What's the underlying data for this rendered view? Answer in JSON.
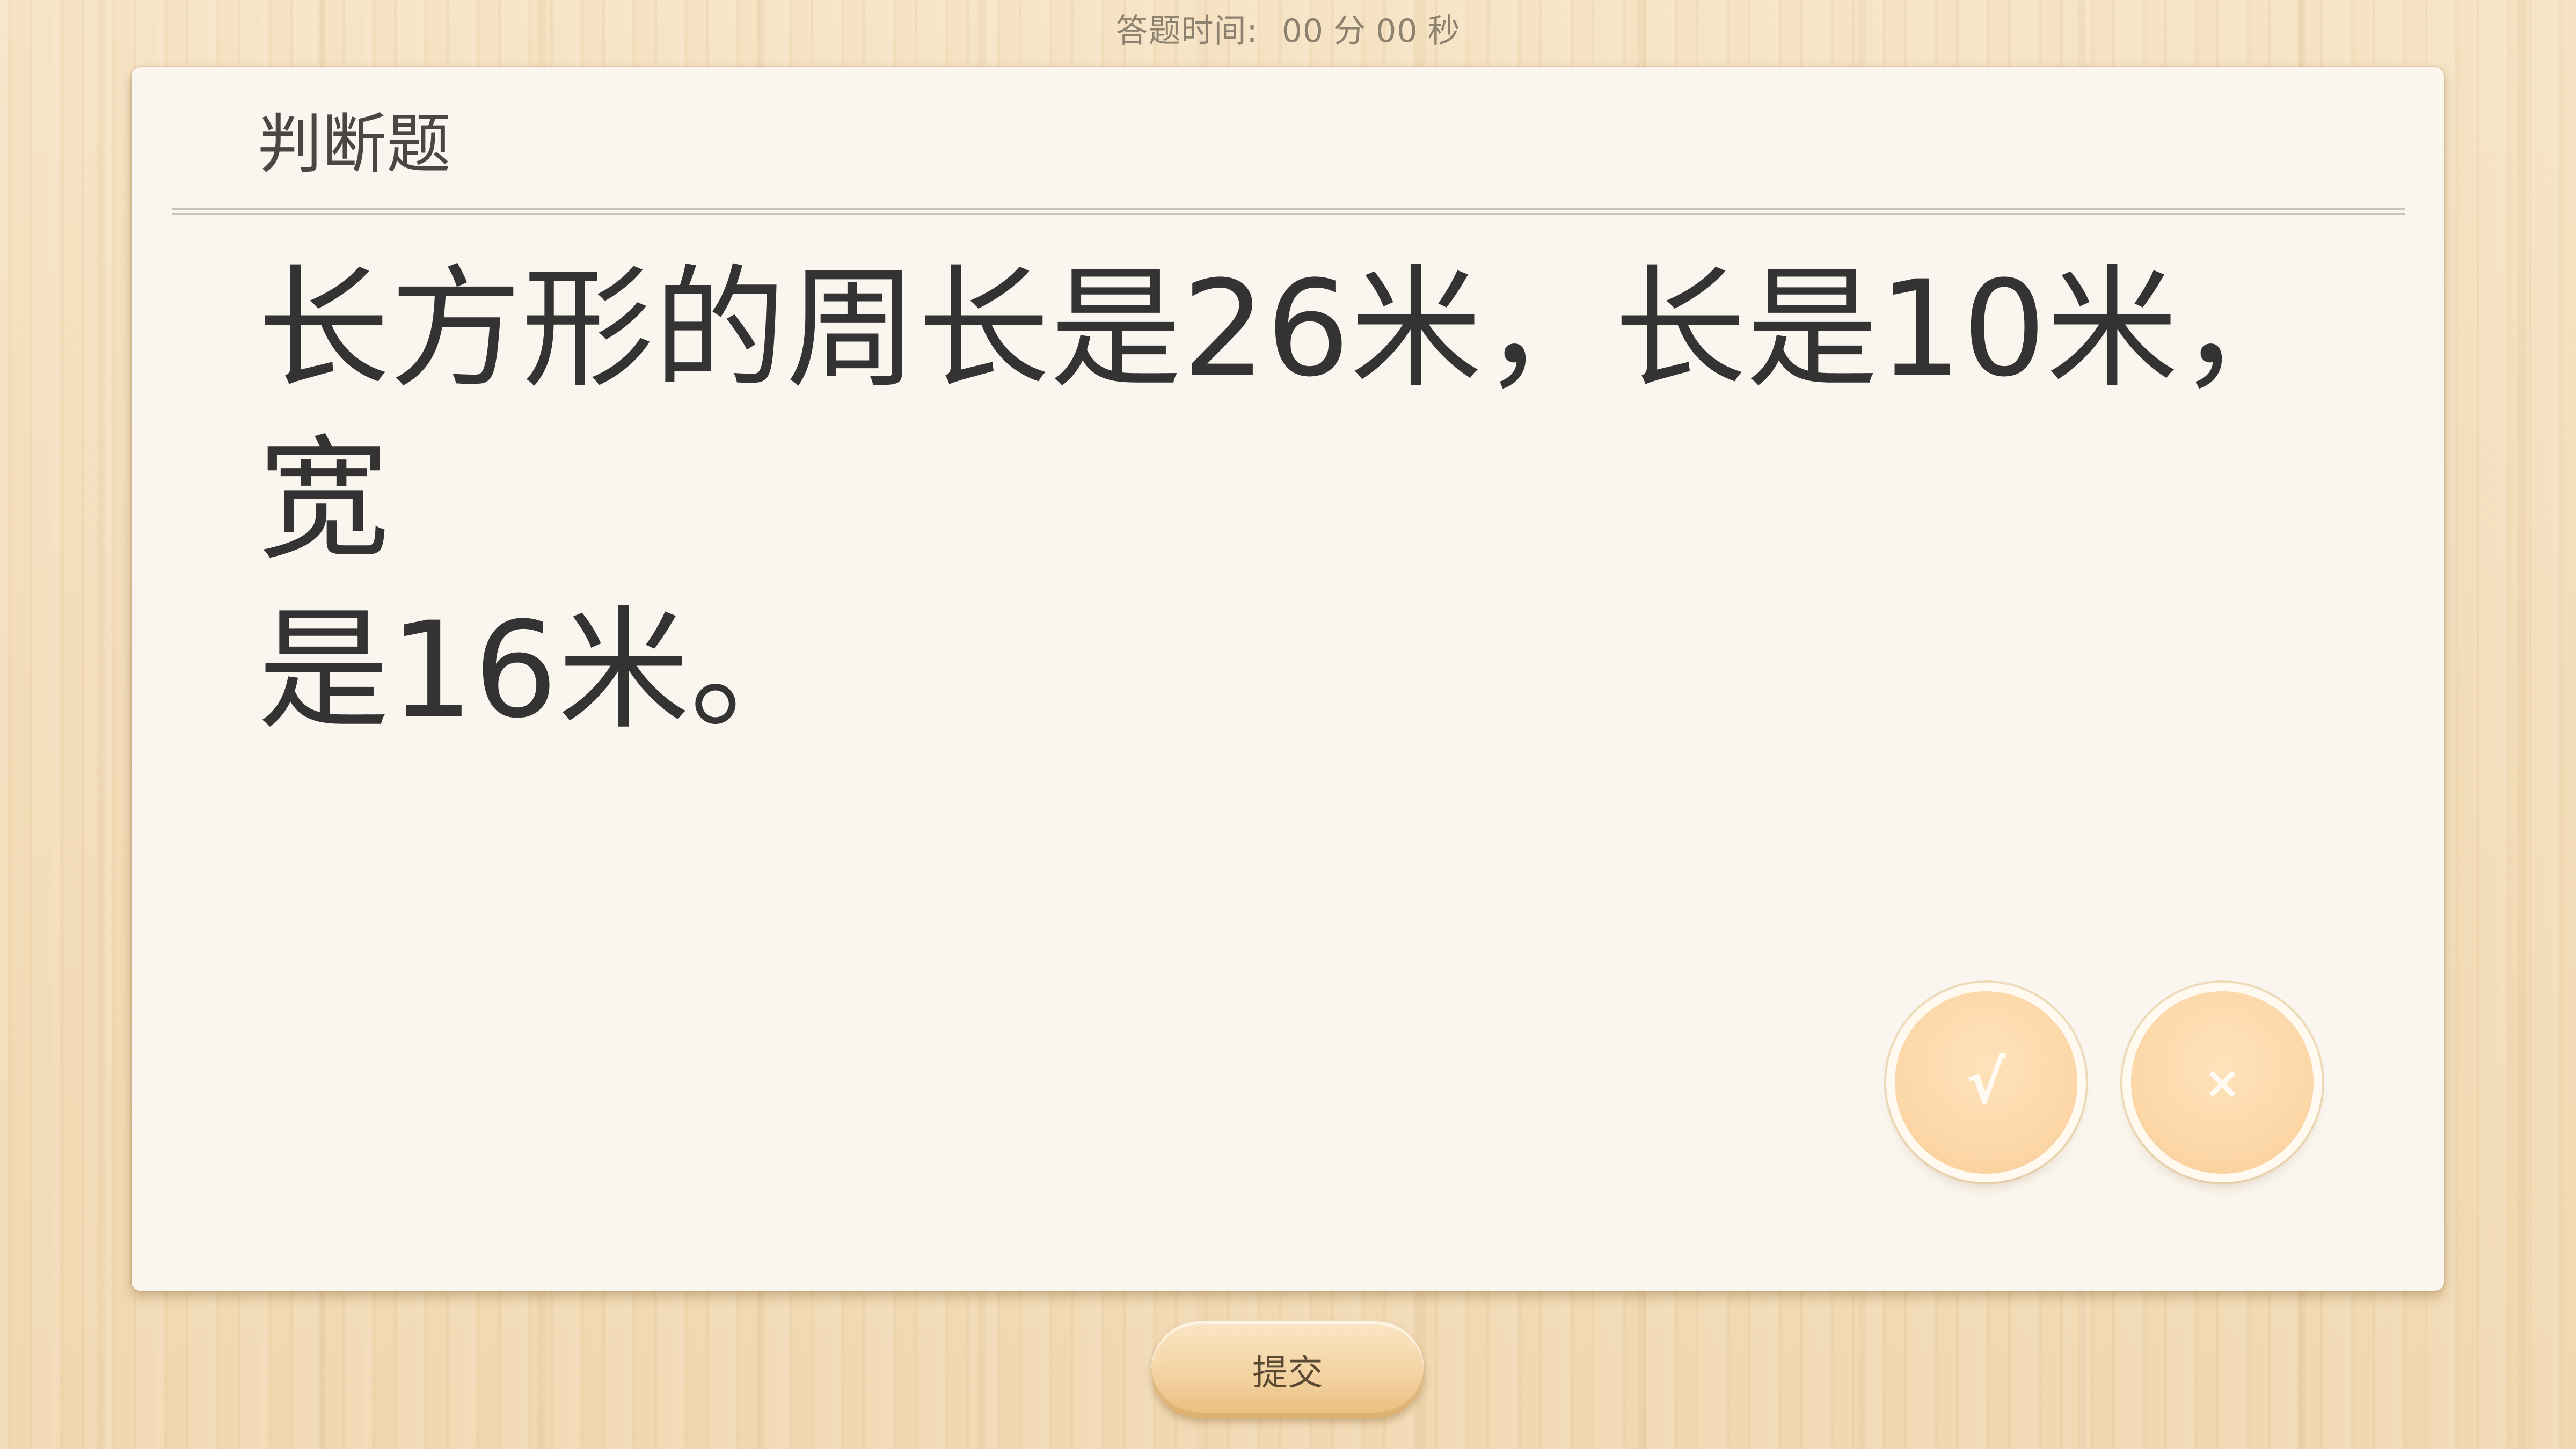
{
  "timer": {
    "label": "答题时间:",
    "minutes": "00",
    "minutes_unit": "分",
    "seconds": "00",
    "seconds_unit": "秒"
  },
  "question": {
    "type": "判断题",
    "line1": "长方形的周长是26米，长是10米，宽",
    "line2": "是16米。"
  },
  "choices": {
    "true_label": "√",
    "false_label": "×"
  },
  "submit_label": "提交",
  "colors": {
    "background": "#f4dfbf",
    "card": "#faf6ef",
    "choice_button": "#fcd7a7",
    "text": "#333333"
  }
}
